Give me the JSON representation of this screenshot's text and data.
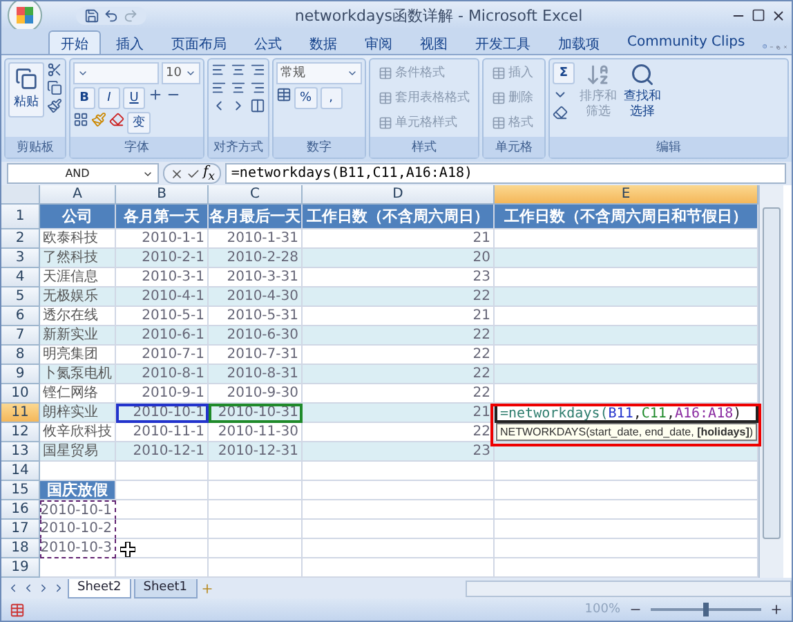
{
  "window": {
    "title": "networkdays函数详解 - Microsoft Excel"
  },
  "tabs": [
    {
      "label": "开始",
      "selected": true
    },
    {
      "label": "插入",
      "selected": false
    },
    {
      "label": "页面布局",
      "selected": false
    },
    {
      "label": "公式",
      "selected": false
    },
    {
      "label": "数据",
      "selected": false
    },
    {
      "label": "审阅",
      "selected": false
    },
    {
      "label": "视图",
      "selected": false
    },
    {
      "label": "开发工具",
      "selected": false
    },
    {
      "label": "加载项",
      "selected": false
    },
    {
      "label": "Community Clips",
      "selected": false
    }
  ],
  "ribbon": {
    "clipboard": {
      "paste": "粘贴",
      "label": "剪贴板"
    },
    "font": {
      "size": "10",
      "bold": "B",
      "italic": "I",
      "underline": "U",
      "phonetic": "变",
      "label": "字体"
    },
    "alignment": {
      "label": "对齐方式"
    },
    "number": {
      "format": "常规",
      "percent": "%",
      "comma": ",",
      "label": "数字"
    },
    "styles": {
      "disabled": true,
      "items": [
        "条件格式",
        "套用表格格式",
        "单元格样式"
      ],
      "label": "样式"
    },
    "cells": {
      "disabled": true,
      "items": [
        "插入",
        "删除",
        "格式"
      ],
      "label": "单元格"
    },
    "editing": {
      "sum": "Σ",
      "sort": "排序和筛选",
      "find": "查找和选择",
      "label": "编辑"
    }
  },
  "formula_bar": {
    "name_box": "AND",
    "fx": "f$_{x}$",
    "formula": "=networkdays(B11,C11,A16:A18)"
  },
  "columns": [
    {
      "label": "A",
      "selected": false
    },
    {
      "label": "B",
      "selected": false
    },
    {
      "label": "C",
      "selected": false
    },
    {
      "label": "D",
      "selected": false
    },
    {
      "label": "E",
      "selected": true
    }
  ],
  "rows": [
    {
      "number": "1",
      "selected": false,
      "shaded": false,
      "cells": [
        {
          "kind": "header",
          "text": "公司"
        },
        {
          "kind": "header",
          "text": "各月第一天"
        },
        {
          "kind": "header",
          "text": "各月最后一天"
        },
        {
          "kind": "header",
          "text": "工作日数（不含周六周日）"
        },
        {
          "kind": "header",
          "text": "工作日数（不含周六周日和节假日）"
        }
      ]
    },
    {
      "number": "2",
      "selected": false,
      "shaded": false,
      "cells": [
        {
          "kind": "text",
          "text": "欧泰科技"
        },
        {
          "kind": "value",
          "text": "2010-1-1"
        },
        {
          "kind": "value",
          "text": "2010-1-31"
        },
        {
          "kind": "value",
          "text": "21"
        },
        {
          "kind": "empty"
        }
      ]
    },
    {
      "number": "3",
      "selected": false,
      "shaded": true,
      "cells": [
        {
          "kind": "text",
          "text": "了然科技"
        },
        {
          "kind": "value",
          "text": "2010-2-1"
        },
        {
          "kind": "value",
          "text": "2010-2-28"
        },
        {
          "kind": "value",
          "text": "20"
        },
        {
          "kind": "empty"
        }
      ]
    },
    {
      "number": "4",
      "selected": false,
      "shaded": false,
      "cells": [
        {
          "kind": "text",
          "text": "天涯信息"
        },
        {
          "kind": "value",
          "text": "2010-3-1"
        },
        {
          "kind": "value",
          "text": "2010-3-31"
        },
        {
          "kind": "value",
          "text": "23"
        },
        {
          "kind": "empty"
        }
      ]
    },
    {
      "number": "5",
      "selected": false,
      "shaded": true,
      "cells": [
        {
          "kind": "text",
          "text": "无极娱乐"
        },
        {
          "kind": "value",
          "text": "2010-4-1"
        },
        {
          "kind": "value",
          "text": "2010-4-30"
        },
        {
          "kind": "value",
          "text": "22"
        },
        {
          "kind": "empty"
        }
      ]
    },
    {
      "number": "6",
      "selected": false,
      "shaded": false,
      "cells": [
        {
          "kind": "text",
          "text": "透尔在线"
        },
        {
          "kind": "value",
          "text": "2010-5-1"
        },
        {
          "kind": "value",
          "text": "2010-5-31"
        },
        {
          "kind": "value",
          "text": "21"
        },
        {
          "kind": "empty"
        }
      ]
    },
    {
      "number": "7",
      "selected": false,
      "shaded": true,
      "cells": [
        {
          "kind": "text",
          "text": "新新实业"
        },
        {
          "kind": "value",
          "text": "2010-6-1"
        },
        {
          "kind": "value",
          "text": "2010-6-30"
        },
        {
          "kind": "value",
          "text": "22"
        },
        {
          "kind": "empty"
        }
      ]
    },
    {
      "number": "8",
      "selected": false,
      "shaded": false,
      "cells": [
        {
          "kind": "text",
          "text": "明亮集团"
        },
        {
          "kind": "value",
          "text": "2010-7-1"
        },
        {
          "kind": "value",
          "text": "2010-7-31"
        },
        {
          "kind": "value",
          "text": "22"
        },
        {
          "kind": "empty"
        }
      ]
    },
    {
      "number": "9",
      "selected": false,
      "shaded": true,
      "cells": [
        {
          "kind": "text",
          "text": "卜氮泵电机"
        },
        {
          "kind": "value",
          "text": "2010-8-1"
        },
        {
          "kind": "value",
          "text": "2010-8-31"
        },
        {
          "kind": "value",
          "text": "22"
        },
        {
          "kind": "empty"
        }
      ]
    },
    {
      "number": "10",
      "selected": false,
      "shaded": false,
      "cells": [
        {
          "kind": "text",
          "text": "铿仁网络"
        },
        {
          "kind": "value",
          "text": "2010-9-1"
        },
        {
          "kind": "value",
          "text": "2010-9-30"
        },
        {
          "kind": "value",
          "text": "22"
        },
        {
          "kind": "empty"
        }
      ]
    },
    {
      "number": "11",
      "selected": true,
      "shaded": true,
      "cells": [
        {
          "kind": "text",
          "text": "朗梓实业"
        },
        {
          "kind": "value",
          "text": "2010-10-1",
          "color": "#2233cc"
        },
        {
          "kind": "value",
          "text": "2010-10-31",
          "color": "#1f8a2a"
        },
        {
          "kind": "value",
          "text": "21"
        },
        {
          "kind": "formula",
          "segments": [
            {
              "text": "=networkdays(",
              "color": "#2e7d6e"
            },
            {
              "text": "B11",
              "color": "#2233cc"
            },
            {
              "text": ",",
              "color": "#222222"
            },
            {
              "text": "C11",
              "color": "#1f8a2a"
            },
            {
              "text": ",",
              "color": "#222222"
            },
            {
              "text": "A16:A18",
              "color": "#8a2aa0"
            },
            {
              "text": ")",
              "color": "#222222"
            }
          ],
          "tooltip": "NETWORKDAYS(start_date, end_date, **[holidays]**)"
        }
      ]
    },
    {
      "number": "12",
      "selected": false,
      "shaded": false,
      "cells": [
        {
          "kind": "text",
          "text": "攸辛欣科技"
        },
        {
          "kind": "value",
          "text": "2010-11-1"
        },
        {
          "kind": "value",
          "text": "2010-11-30"
        },
        {
          "kind": "value",
          "text": "22"
        },
        {
          "kind": "empty"
        }
      ]
    },
    {
      "number": "13",
      "selected": false,
      "shaded": true,
      "cells": [
        {
          "kind": "text",
          "text": "国星贸易"
        },
        {
          "kind": "value",
          "text": "2010-12-1"
        },
        {
          "kind": "value",
          "text": "2010-12-31"
        },
        {
          "kind": "value",
          "text": "23"
        },
        {
          "kind": "empty"
        }
      ]
    },
    {
      "number": "14",
      "selected": false,
      "shaded": false,
      "cells": []
    },
    {
      "number": "15",
      "selected": false,
      "shaded": false,
      "cells": [
        {
          "kind": "header",
          "text": "国庆放假"
        }
      ]
    },
    {
      "number": "16",
      "selected": false,
      "shaded": false,
      "cells": [
        {
          "kind": "value",
          "text": "2010-10-1",
          "marquee": true
        }
      ]
    },
    {
      "number": "17",
      "selected": false,
      "shaded": false,
      "cells": [
        {
          "kind": "value",
          "text": "2010-10-2",
          "marquee": true
        }
      ]
    },
    {
      "number": "18",
      "selected": false,
      "shaded": false,
      "cells": [
        {
          "kind": "value",
          "text": "2010-10-3",
          "marquee": true,
          "cursor": true
        }
      ]
    },
    {
      "number": "19",
      "selected": false,
      "shaded": false,
      "cells": []
    }
  ],
  "sheets": [
    {
      "label": "Sheet2",
      "selected": true
    },
    {
      "label": "Sheet1",
      "selected": false
    }
  ],
  "status_bar": {
    "zoom": "100%",
    "level": 0.5
  }
}
